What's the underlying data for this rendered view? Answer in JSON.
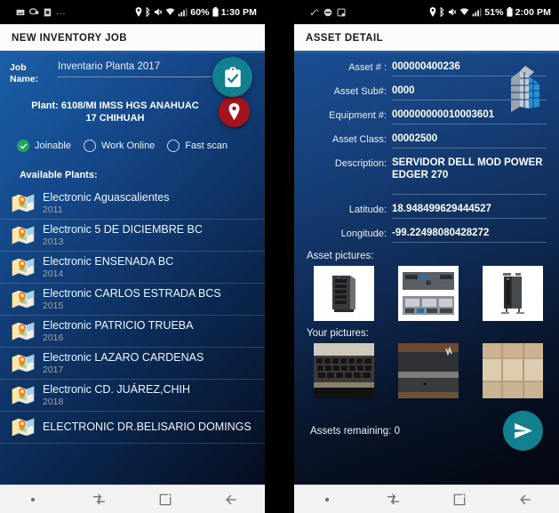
{
  "left_phone": {
    "status_bar": {
      "left_icons": [
        "image-icon",
        "message-icon",
        "sim-icon"
      ],
      "overflow": "...",
      "right_icons": [
        "location-icon",
        "bluetooth-icon",
        "mute-icon",
        "wifi-icon",
        "signal-icon"
      ],
      "battery": "60%",
      "time": "1:30 PM"
    },
    "appbar": {
      "title": "NEW INVENTORY JOB"
    },
    "form": {
      "job_name_label": "Job Name:",
      "job_name_value": "Inventario Planta 2017",
      "plant_label": "Plant:",
      "plant_value_line1": "6108/MI IMSS HGS ANAHUAC",
      "plant_value_line2": "17 CHIHUAH",
      "options": [
        {
          "label": "Joinable",
          "checked": true
        },
        {
          "label": "Work Online",
          "checked": false
        },
        {
          "label": "Fast scan",
          "checked": false
        }
      ],
      "available_plants_label": "Available Plants:"
    },
    "plants": [
      {
        "name": "Electronic Aguascalientes",
        "year": "2011"
      },
      {
        "name": "Electronic 5 DE DICIEMBRE BC",
        "year": "2013"
      },
      {
        "name": "Electronic ENSENADA BC",
        "year": "2014"
      },
      {
        "name": "Electronic  CARLOS ESTRADA BCS",
        "year": "2015"
      },
      {
        "name": "Electronic PATRICIO TRUEBA",
        "year": "2016"
      },
      {
        "name": "Electronic LAZARO CARDENAS",
        "year": "2017"
      },
      {
        "name": "Electronic CD. JUÁREZ,CHIH",
        "year": "2018"
      },
      {
        "name": "ELECTRONIC DR.BELISARIO DOMINGS",
        "year": ""
      }
    ],
    "fab_location": "location-pin-fab",
    "fab_confirm": "clipboard-check-fab",
    "nav": [
      "recents-dot",
      "multitask-icon",
      "home-icon",
      "back-icon"
    ]
  },
  "right_phone": {
    "status_bar": {
      "left_icons": [
        "vibrate-icon",
        "do-not-disturb-icon",
        "screenshot-icon"
      ],
      "right_icons": [
        "location-icon",
        "bluetooth-icon",
        "mute-icon",
        "wifi-icon",
        "signal-icon"
      ],
      "battery": "51%",
      "time": "2:00 PM"
    },
    "appbar": {
      "title": "ASSET DETAIL"
    },
    "details": [
      {
        "label": "Asset # :",
        "value": "000000400236"
      },
      {
        "label": "Asset Sub#:",
        "value": "0000"
      },
      {
        "label": "Equipment #:",
        "value": "000000000010003601"
      },
      {
        "label": "Asset Class:",
        "value": "00002500"
      },
      {
        "label": "Description:",
        "value": "SERVIDOR DELL MOD POWER EDGER 270"
      },
      {
        "label": "Latitude:",
        "value": "18.948499629444527"
      },
      {
        "label": "Longitude:",
        "value": "-99.22498080428272"
      }
    ],
    "asset_pictures_label": "Asset pictures:",
    "your_pictures_label": "Your pictures:",
    "asset_pictures": [
      "dell-tower-server",
      "rack-server-front-back",
      "tower-server-white"
    ],
    "your_pictures": [
      "keyboard-photo",
      "dark-room-photo",
      "wooden-floor-photo"
    ],
    "assets_remaining": "Assets remaining: 0",
    "fab_send": "send-icon-fab",
    "nav": [
      "recents-dot",
      "multitask-icon",
      "home-icon",
      "back-icon"
    ]
  },
  "colors": {
    "accent_teal": "#12808f",
    "accent_red": "#a4141f",
    "accent_green": "#1fa463",
    "appbar_rule": "#1f5fa8"
  }
}
